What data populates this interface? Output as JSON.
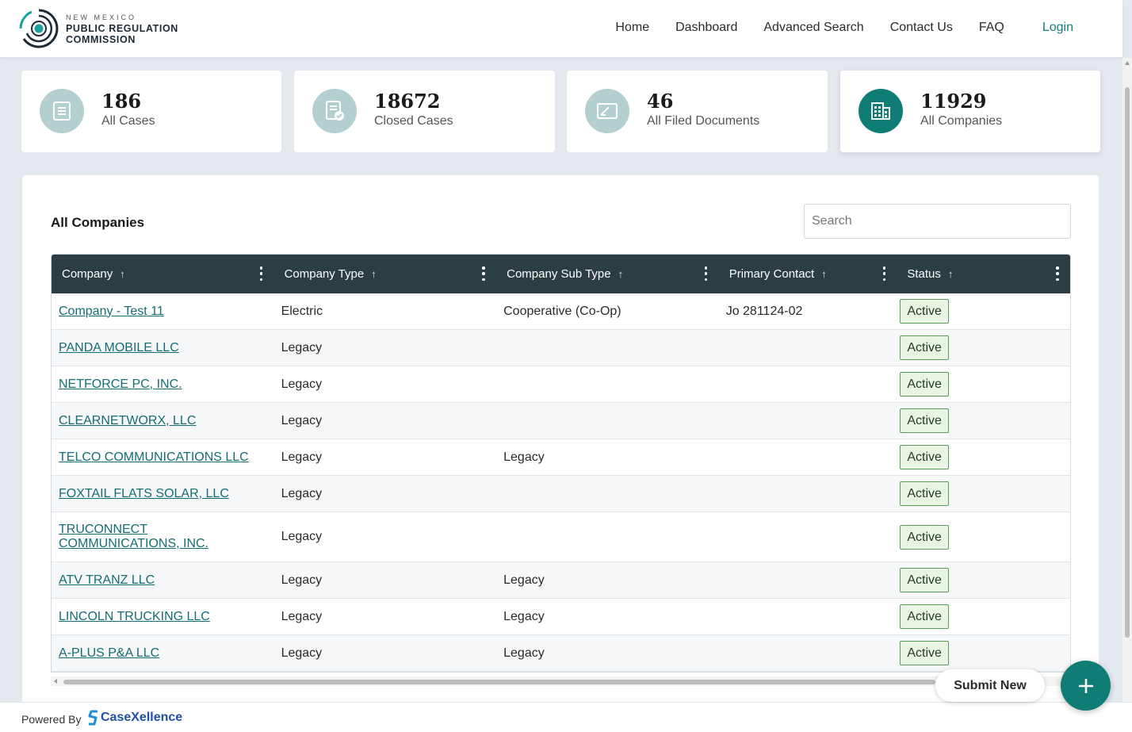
{
  "header": {
    "logo": {
      "line1": "NEW MEXICO",
      "line2": "PUBLIC REGULATION",
      "line3": "COMMISSION"
    },
    "nav": [
      "Home",
      "Dashboard",
      "Advanced Search",
      "Contact Us",
      "FAQ"
    ],
    "login": "Login"
  },
  "stats": [
    {
      "value": "186",
      "label": "All Cases",
      "icon": "document-list-icon"
    },
    {
      "value": "18672",
      "label": "Closed Cases",
      "icon": "document-check-icon"
    },
    {
      "value": "46",
      "label": "All Filed Documents",
      "icon": "filed-document-icon"
    },
    {
      "value": "11929",
      "label": "All Companies",
      "icon": "building-icon"
    }
  ],
  "panel": {
    "title": "All Companies",
    "search_placeholder": "Search"
  },
  "table": {
    "columns": [
      "Company",
      "Company Type",
      "Company Sub Type",
      "Primary Contact",
      "Status"
    ],
    "rows": [
      {
        "company": "Company - Test 11",
        "type": "Electric",
        "subtype": "Cooperative (Co-Op)",
        "contact": "Jo 281124-02",
        "status": "Active"
      },
      {
        "company": "PANDA MOBILE LLC",
        "type": "Legacy",
        "subtype": "",
        "contact": "",
        "status": "Active"
      },
      {
        "company": "NETFORCE PC, INC.",
        "type": "Legacy",
        "subtype": "",
        "contact": "",
        "status": "Active"
      },
      {
        "company": "CLEARNETWORX, LLC",
        "type": "Legacy",
        "subtype": "",
        "contact": "",
        "status": "Active"
      },
      {
        "company": "TELCO COMMUNICATIONS LLC",
        "type": "Legacy",
        "subtype": "Legacy",
        "contact": "",
        "status": "Active"
      },
      {
        "company": "FOXTAIL FLATS SOLAR, LLC",
        "type": "Legacy",
        "subtype": "",
        "contact": "",
        "status": "Active"
      },
      {
        "company": "TRUCONNECT COMMUNICATIONS, INC.",
        "type": "Legacy",
        "subtype": "",
        "contact": "",
        "status": "Active"
      },
      {
        "company": "ATV TRANZ LLC",
        "type": "Legacy",
        "subtype": "Legacy",
        "contact": "",
        "status": "Active"
      },
      {
        "company": "LINCOLN TRUCKING LLC",
        "type": "Legacy",
        "subtype": "Legacy",
        "contact": "",
        "status": "Active"
      },
      {
        "company": "A-PLUS P&A LLC",
        "type": "Legacy",
        "subtype": "Legacy",
        "contact": "",
        "status": "Active"
      }
    ]
  },
  "footer": {
    "powered_by": "Powered By",
    "brand": "CaseXellence"
  },
  "submit": {
    "label": "Submit New"
  },
  "colors": {
    "accent": "#0f7c75",
    "header_bg": "#2c3e42",
    "link": "#156d73",
    "badge_bg": "#e7f5e2",
    "badge_border": "#5a9a5a"
  }
}
